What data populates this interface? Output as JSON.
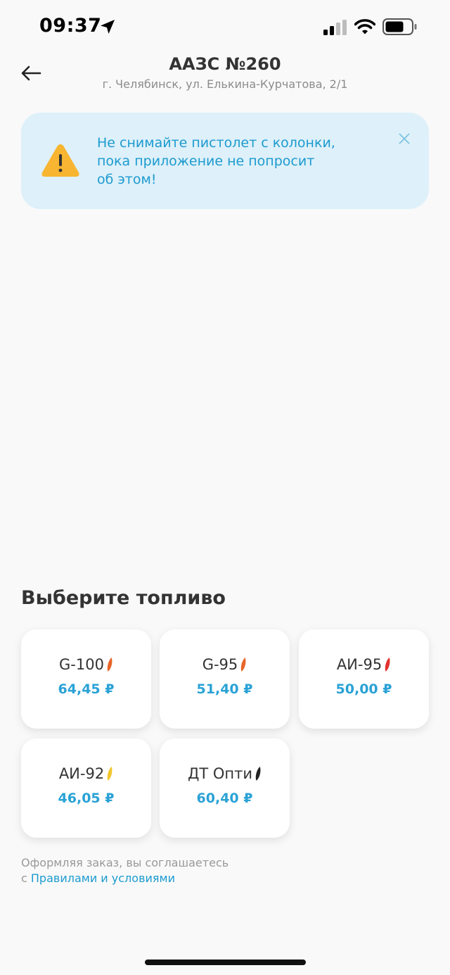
{
  "status_bar": {
    "time": "09:37"
  },
  "header": {
    "title": "ААЗС №260",
    "address": "г. Челябинск, ул. Елькина-Курчатова, 2/1",
    "back_icon": "arrow-left-icon"
  },
  "alert": {
    "lines": [
      "Не снимайте пистолет с колонки,",
      "пока приложение не попросит",
      "об этом!"
    ],
    "icon": "warning-triangle-icon",
    "close_icon": "close-icon",
    "background_color": "#def0f9",
    "text_color": "#1c9bd0"
  },
  "fuel_section": {
    "title": "Выберите топливо",
    "fuels": [
      {
        "name": "G-100",
        "price": "64,45 ₽",
        "drop_color": "#e8652a"
      },
      {
        "name": "G-95",
        "price": "51,40 ₽",
        "drop_color": "#e8652a"
      },
      {
        "name": "АИ-95",
        "price": "50,00 ₽",
        "drop_color": "#e0322f"
      },
      {
        "name": "АИ-92",
        "price": "46,05 ₽",
        "drop_color": "#f2c62c"
      },
      {
        "name": "ДТ Опти",
        "price": "60,40 ₽",
        "drop_color": "#222222"
      }
    ]
  },
  "terms": {
    "prefix": "Оформляя заказ, вы соглашаетесь",
    "line2_prefix": "с",
    "link": "Правилами и условиями"
  },
  "colors": {
    "accent": "#2aa2d6",
    "warning": "#f7b531"
  }
}
